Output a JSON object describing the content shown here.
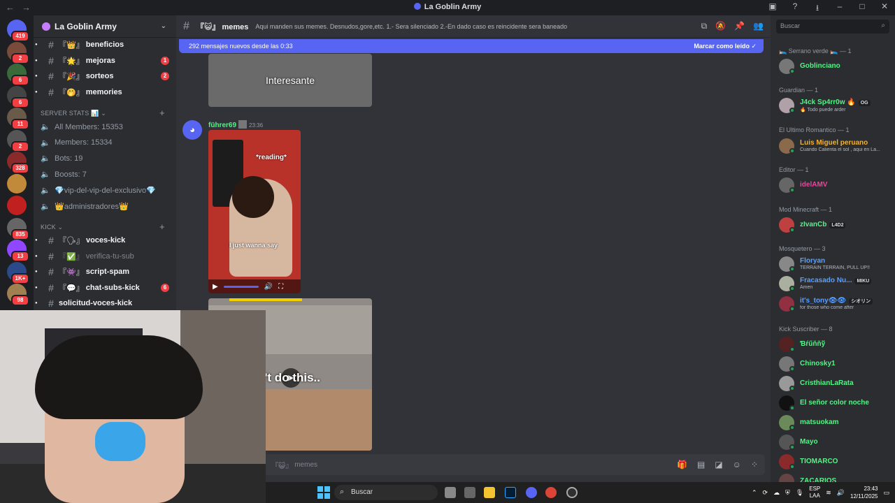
{
  "window": {
    "title": "La Goblin Army"
  },
  "servers": [
    {
      "badge": "419",
      "color": "#5865f2"
    },
    {
      "badge": "2",
      "color": "#7a4a3a"
    },
    {
      "badge": "6",
      "color": "#3b6a3a"
    },
    {
      "badge": "6",
      "color": "#444444"
    },
    {
      "badge": "11",
      "color": "#6a5a4a"
    },
    {
      "badge": "2",
      "color": "#555555"
    },
    {
      "badge": "328",
      "color": "#8a2a2a"
    },
    {
      "badge": "",
      "color": "#c08a3a"
    },
    {
      "badge": "",
      "color": "#c02020"
    },
    {
      "badge": "835",
      "color": "#666666"
    },
    {
      "badge": "13",
      "color": "#9146ff"
    },
    {
      "badge": "1K+",
      "color": "#2a4a8a"
    },
    {
      "badge": "98",
      "color": "#a08050"
    }
  ],
  "sidebar": {
    "server_name": "La Goblin Army",
    "top_channels": [
      {
        "emoji": "『👑』",
        "label": "beneficios",
        "count": ""
      },
      {
        "emoji": "『🌟』",
        "label": "mejoras",
        "count": "1"
      },
      {
        "emoji": "『🎉』",
        "label": "sorteos",
        "count": "2"
      },
      {
        "emoji": "『🤭』",
        "label": "memories",
        "count": ""
      }
    ],
    "stats_category": "SERVER STATS 📊",
    "stats": [
      "All Members: 15353",
      "Members: 15334",
      "Bots: 19",
      "Boosts: 7",
      "💎vip-del-vip-del-exclusivo💎",
      "👑administradores👑"
    ],
    "kick_category": "kick",
    "kick_channels": [
      {
        "emoji": "『🗣』",
        "label": "voces-kick",
        "count": "",
        "muted": false
      },
      {
        "emoji": "『✅』",
        "label": "verifica-tu-sub",
        "count": "",
        "muted": true
      },
      {
        "emoji": "『👾』",
        "label": "script-spam",
        "count": "",
        "muted": false
      },
      {
        "emoji": "『💬』",
        "label": "chat-subs-kick",
        "count": "6",
        "muted": false
      },
      {
        "emoji": "",
        "label": "solicitud-voces-kick",
        "count": "",
        "muted": false
      }
    ]
  },
  "channel": {
    "emoji": "『😺』",
    "name": "memes",
    "topic": "Aqui manden sus memes. Desnudos,gore,etc. 1.- Sera silenciado 2.-En dado caso es reincidente sera baneado",
    "new_messages": "292 mensajes nuevos desde las 0:33",
    "mark_read": "Marcar como leído"
  },
  "messages": {
    "caption1": "Interesante",
    "author": "führer69",
    "time": "23:36",
    "video_text1": "*reading*",
    "video_text2": "I just wanna say",
    "caption2": "n't do this.."
  },
  "composer": {
    "placeholder_emoji": "『😺』",
    "placeholder": "memes"
  },
  "search": {
    "placeholder": "Buscar"
  },
  "member_groups": [
    {
      "title": "🛌 Serrano verde 🛌 — 1"
    },
    {
      "title": "Guardian — 1"
    },
    {
      "title": "El Ultimo Romantico — 1"
    },
    {
      "title": "Editor — 1"
    },
    {
      "title": "Mod Minecraft — 1"
    },
    {
      "title": "Mosquetero — 3"
    },
    {
      "title": "Kick Suscriber — 8"
    }
  ],
  "members": [
    {
      "name": "Goblinciano",
      "sub": "",
      "tag": "",
      "color": "#57f287",
      "avatar": "#777777"
    },
    {
      "name": "J4ck Sp4rr0w 🔥",
      "sub": "🔥 Todo puede arder",
      "tag": "OG",
      "color": "#57f287",
      "avatar": "#b0a0a8"
    },
    {
      "name": "Luis Miguel peruano",
      "sub": "Cuando Calienta el sol , aqui en La...",
      "tag": "",
      "color": "#f0b232",
      "avatar": "#8a6a4a"
    },
    {
      "name": "idelAMV",
      "sub": "",
      "tag": "",
      "color": "#eb459e",
      "avatar": "#666666"
    },
    {
      "name": "zIvanCb",
      "sub": "",
      "tag": "L4D2",
      "color": "#57f287",
      "avatar": "#c04040"
    },
    {
      "name": "Floryan",
      "sub": "TERRAIN TERRAIN, PULL UP!!",
      "tag": "",
      "color": "#5aa0ff",
      "avatar": "#888888"
    },
    {
      "name": "Fracasado Nu...",
      "sub": "Amen",
      "tag": "MIKU",
      "color": "#5aa0ff",
      "avatar": "#aab0a0"
    },
    {
      "name": "it's_tony👁👁",
      "sub": "for those who come after",
      "tag": "シオリン",
      "color": "#5aa0ff",
      "avatar": "#903040"
    },
    {
      "name": "Ɓŕűňňў",
      "sub": "",
      "tag": "",
      "color": "#57f287",
      "avatar": "#552222"
    },
    {
      "name": "Chinosky1",
      "sub": "",
      "tag": "",
      "color": "#57f287",
      "avatar": "#777777"
    },
    {
      "name": "CristhianLaRata",
      "sub": "",
      "tag": "",
      "color": "#57f287",
      "avatar": "#999999"
    },
    {
      "name": "El señor color noche",
      "sub": "",
      "tag": "",
      "color": "#57f287",
      "avatar": "#111111"
    },
    {
      "name": "matsuokam",
      "sub": "",
      "tag": "",
      "color": "#57f287",
      "avatar": "#6a8a5a"
    },
    {
      "name": "Mayo",
      "sub": "",
      "tag": "",
      "color": "#57f287",
      "avatar": "#555555"
    },
    {
      "name": "TIOMARCO",
      "sub": "",
      "tag": "",
      "color": "#57f287",
      "avatar": "#8a2a2a"
    },
    {
      "name": "ZACARIOS",
      "sub": "",
      "tag": "",
      "color": "#57f287",
      "avatar": "#664444"
    }
  ],
  "taskbar": {
    "search": "Buscar",
    "lang_top": "ESP",
    "lang_bottom": "LAA",
    "time": "23:43",
    "date": "12/11/2025"
  }
}
